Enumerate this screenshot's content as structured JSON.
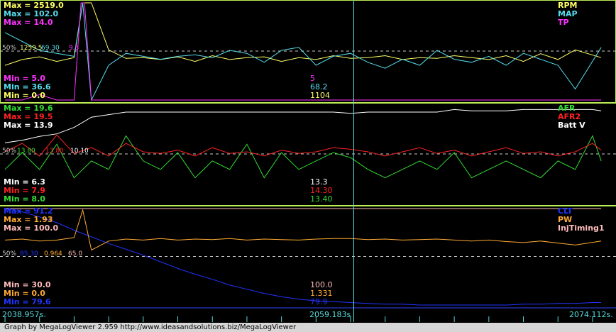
{
  "colors": {
    "rpm": "#ffff66",
    "map": "#55ddee",
    "tp": "#ff33ff",
    "afr": "#33dd33",
    "afr2": "#ff2222",
    "batt": "#ffffff",
    "clt": "#2233ff",
    "pw": "#ffaa33",
    "inj": "#ffbbbb",
    "sep": "#bbee55",
    "grid": "#cccccc",
    "cursor": "#55dddd",
    "axis": "#55dddd"
  },
  "panel1": {
    "legend": [
      "RPM",
      "MAP",
      "TP"
    ],
    "max": {
      "rpm": "Max = 2519.0",
      "map": "Max = 102.0",
      "tp": "Max = 14.0"
    },
    "min": {
      "tp": "Min = 5.0",
      "map": "Min = 36.6",
      "rpm": "Min = 0.0"
    },
    "mid_label": "50%",
    "mid_values": {
      "rpm": "1259.5",
      "map": "69.30",
      "tp": "9.5"
    },
    "cursor_values": {
      "tp": "5",
      "map": "68.2",
      "rpm": "1104"
    }
  },
  "panel2": {
    "legend": [
      "AFR",
      "AFR2",
      "Batt V"
    ],
    "max": {
      "afr": "Max = 19.6",
      "afr2": "Max = 19.5",
      "batt": "Max = 13.9"
    },
    "min": {
      "batt": "Min = 6.3",
      "afr2": "Min = 7.9",
      "afr": "Min = 8.0"
    },
    "mid_label": "50%",
    "mid_values": {
      "afr": "13.80",
      "afr2": "13.80",
      "batt": "10.10"
    },
    "cursor_values": {
      "batt": "13.3",
      "afr2": "14.30",
      "afr": "13.40"
    }
  },
  "panel3": {
    "legend": [
      "CLT",
      "PW",
      "InjTiming1"
    ],
    "max": {
      "clt": "Max = 91.2",
      "pw": "Max = 1.93",
      "inj": "Max = 100.0"
    },
    "min": {
      "inj": "Min = 30.0",
      "pw": "Min = 0.0",
      "clt": "Min = 79.6"
    },
    "mid_label": "50%",
    "mid_values": {
      "clt": "85.30",
      "pw": "0.964",
      "inj": "65.0"
    },
    "cursor_values": {
      "inj": "100.0",
      "pw": "1.331",
      "clt": "79.9"
    }
  },
  "time_axis": {
    "start": "2038.957s.",
    "cursor": "2059.183s",
    "end": "2074.112s."
  },
  "footer": "Graph by MegaLogViewer 2.959 http://www.ideasandsolutions.biz/MegaLogViewer",
  "chart_data": [
    {
      "type": "line",
      "x_range": [
        2038.957,
        2074.112
      ],
      "cursor_x": 2059.183,
      "series": [
        {
          "name": "RPM",
          "min": 0.0,
          "max": 2519.0,
          "x": [
            2039,
            2040,
            2041,
            2042,
            2043,
            2043.5,
            2044,
            2045,
            2046,
            2047,
            2048,
            2049,
            2050,
            2051,
            2052,
            2053,
            2054,
            2055,
            2056,
            2057,
            2058,
            2059,
            2060,
            2061,
            2062,
            2063,
            2064,
            2065,
            2066,
            2067,
            2068,
            2069,
            2070,
            2071,
            2072,
            2073.5
          ],
          "values": [
            900,
            1050,
            1120,
            1000,
            1100,
            2519,
            2519,
            1300,
            1080,
            1100,
            1050,
            1120,
            1000,
            1150,
            1050,
            1100,
            1120,
            1000,
            1100,
            1050,
            1150,
            1080,
            1100,
            1150,
            1050,
            1100,
            1080,
            1150,
            1100,
            1050,
            1150,
            1000,
            1200,
            1050,
            1300,
            1100
          ]
        },
        {
          "name": "MAP",
          "min": 36.6,
          "max": 102.0,
          "x": [
            2039,
            2040,
            2041,
            2042,
            2043,
            2043.5,
            2044,
            2045,
            2046,
            2047,
            2048,
            2049,
            2050,
            2051,
            2052,
            2053,
            2054,
            2055,
            2056,
            2057,
            2058,
            2059,
            2060,
            2061,
            2062,
            2063,
            2064,
            2065,
            2066,
            2067,
            2068,
            2069,
            2070,
            2071,
            2072,
            2073.5
          ],
          "values": [
            82,
            76,
            70,
            68,
            66,
            102,
            36.6,
            60,
            68,
            66,
            64,
            66,
            67,
            65,
            70,
            68,
            62,
            70,
            72,
            60,
            66,
            68,
            62,
            58,
            64,
            60,
            70,
            64,
            62,
            66,
            60,
            68,
            64,
            60,
            44,
            72
          ]
        },
        {
          "name": "TP",
          "min": 5.0,
          "max": 14.0,
          "x": [
            2039,
            2040,
            2041,
            2042,
            2043,
            2043.4,
            2043.6,
            2044,
            2050,
            2060,
            2070,
            2073.5
          ],
          "values": [
            5,
            5,
            5.5,
            5,
            5,
            14,
            14,
            5,
            5,
            5,
            5,
            5
          ]
        }
      ]
    },
    {
      "type": "line",
      "x_range": [
        2038.957,
        2074.112
      ],
      "cursor_x": 2059.183,
      "series": [
        {
          "name": "AFR",
          "min": 8.0,
          "max": 19.6,
          "x": [
            2039,
            2040,
            2041,
            2042,
            2043,
            2044,
            2045,
            2046,
            2047,
            2048,
            2049,
            2050,
            2051,
            2052,
            2053,
            2054,
            2055,
            2056,
            2057,
            2058,
            2059,
            2060,
            2061,
            2062,
            2063,
            2064,
            2065,
            2066,
            2067,
            2068,
            2069,
            2070,
            2071,
            2072,
            2073,
            2073.5
          ],
          "values": [
            12,
            14,
            12,
            15,
            11,
            13,
            12,
            16,
            13,
            12,
            14,
            11,
            13,
            12,
            15,
            11,
            14,
            12,
            13,
            14,
            13.4,
            12,
            11,
            12,
            13,
            12,
            14,
            11,
            12,
            13,
            12,
            11,
            13,
            12,
            16,
            13
          ]
        },
        {
          "name": "AFR2",
          "min": 7.9,
          "max": 19.5,
          "x": [
            2039,
            2040,
            2041,
            2042,
            2043,
            2044,
            2045,
            2046,
            2047,
            2048,
            2049,
            2050,
            2051,
            2052,
            2053,
            2054,
            2055,
            2056,
            2057,
            2058,
            2059,
            2060,
            2061,
            2062,
            2063,
            2064,
            2065,
            2066,
            2067,
            2068,
            2069,
            2070,
            2071,
            2072,
            2073,
            2073.5
          ],
          "values": [
            14,
            15,
            13.5,
            16,
            13.8,
            14.5,
            13.5,
            15,
            14,
            13.8,
            14.2,
            13.5,
            14.5,
            13.8,
            14,
            13.5,
            14.2,
            13.8,
            14,
            14.5,
            14.3,
            14,
            13.5,
            14,
            14.5,
            13.8,
            14.2,
            13.5,
            14,
            14.5,
            13.8,
            14,
            13.5,
            14,
            15,
            14.2
          ]
        },
        {
          "name": "Batt V",
          "min": 6.3,
          "max": 13.9,
          "x": [
            2039,
            2040,
            2041,
            2042,
            2043,
            2044,
            2045,
            2046,
            2047,
            2048,
            2049,
            2050,
            2051,
            2052,
            2053,
            2054,
            2055,
            2056,
            2057,
            2058,
            2059,
            2060,
            2061,
            2062,
            2063,
            2064,
            2065,
            2066,
            2067,
            2068,
            2069,
            2070,
            2071,
            2072,
            2073,
            2073.5
          ],
          "values": [
            11,
            11.2,
            11.5,
            11.7,
            12.2,
            13,
            13.2,
            13.4,
            13.4,
            13.4,
            13.4,
            13.4,
            13.4,
            13.4,
            13.4,
            13.4,
            13.4,
            13.4,
            13.4,
            13.4,
            13.3,
            13.4,
            13.4,
            13.4,
            13.4,
            13.4,
            13.6,
            13.5,
            13.5,
            13.5,
            13.6,
            13.6,
            13.6,
            13.6,
            13.6,
            13.5
          ]
        }
      ]
    },
    {
      "type": "line",
      "x_range": [
        2038.957,
        2074.112
      ],
      "cursor_x": 2059.183,
      "series": [
        {
          "name": "CLT",
          "min": 79.6,
          "max": 91.2,
          "x": [
            2039,
            2040,
            2041,
            2042,
            2043,
            2044,
            2045,
            2046,
            2047,
            2048,
            2049,
            2050,
            2051,
            2052,
            2053,
            2054,
            2055,
            2056,
            2057,
            2058,
            2059,
            2060,
            2061,
            2062,
            2063,
            2064,
            2065,
            2066,
            2067,
            2068,
            2069,
            2070,
            2071,
            2072,
            2073,
            2073.5
          ],
          "values": [
            91.2,
            90.8,
            90.2,
            89.5,
            88.6,
            87.8,
            87,
            86.3,
            85.6,
            84.8,
            84,
            83.3,
            82.7,
            82,
            81.5,
            81,
            80.6,
            80.3,
            80.1,
            80,
            79.9,
            79.8,
            79.7,
            79.7,
            79.6,
            79.6,
            79.6,
            79.6,
            79.6,
            79.6,
            79.7,
            79.7,
            79.8,
            79.8,
            79.9,
            79.9
          ]
        },
        {
          "name": "PW",
          "min": 0.0,
          "max": 1.93,
          "x": [
            2039,
            2040,
            2041,
            2042,
            2043,
            2043.5,
            2044,
            2045,
            2046,
            2047,
            2048,
            2049,
            2050,
            2051,
            2052,
            2053,
            2054,
            2055,
            2056,
            2057,
            2058,
            2059,
            2060,
            2061,
            2062,
            2063,
            2064,
            2065,
            2066,
            2067,
            2068,
            2069,
            2070,
            2071,
            2072,
            2073.5
          ],
          "values": [
            1.3,
            1.32,
            1.28,
            1.3,
            1.35,
            1.9,
            1.1,
            1.28,
            1.32,
            1.3,
            1.33,
            1.3,
            1.32,
            1.31,
            1.33,
            1.3,
            1.32,
            1.31,
            1.3,
            1.32,
            1.33,
            1.33,
            1.31,
            1.32,
            1.3,
            1.31,
            1.32,
            1.3,
            1.28,
            1.3,
            1.27,
            1.25,
            1.28,
            1.24,
            1.2,
            1.28
          ]
        },
        {
          "name": "InjTiming1",
          "min": 30.0,
          "max": 100.0,
          "x": [
            2039,
            2073.5
          ],
          "values": [
            100,
            100
          ]
        }
      ]
    }
  ]
}
